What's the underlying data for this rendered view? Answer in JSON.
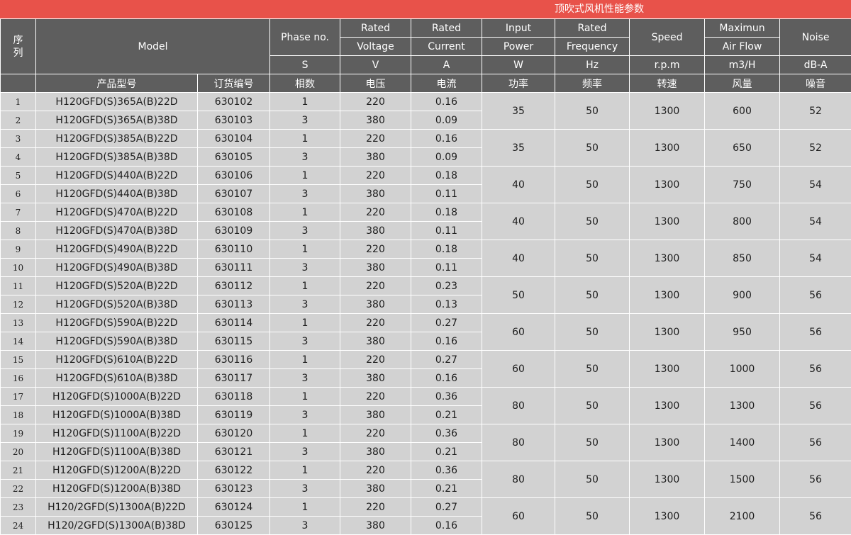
{
  "banner_title": "顶吹式风机性能参数",
  "header": {
    "seq": "序\n列",
    "model": "Model",
    "phase": "Phase no.",
    "rated_voltage_1": "Rated",
    "rated_voltage_2": "Voltage",
    "rated_current_1": "Rated",
    "rated_current_2": "Current",
    "input_power_1": "Input",
    "input_power_2": "Power",
    "rated_freq_1": "Rated",
    "rated_freq_2": "Frequency",
    "speed": "Speed",
    "airflow_1": "Maximun",
    "airflow_2": "Air Flow",
    "noise": "Noise",
    "unit_phase": "S",
    "unit_voltage": "V",
    "unit_current": "A",
    "unit_power": "W",
    "unit_freq": "Hz",
    "unit_speed": "r.p.m",
    "unit_airflow": "m3/H",
    "unit_noise": "dB-A",
    "cn_model": "产品型号",
    "cn_order": "订货编号",
    "cn_phase": "相数",
    "cn_voltage": "电压",
    "cn_current": "电流",
    "cn_power": "功率",
    "cn_freq": "频率",
    "cn_speed": "转速",
    "cn_airflow": "风量",
    "cn_noise": "噪音"
  },
  "rows": [
    {
      "idx": "1",
      "model": "H120GFD(S)365A(B)22D",
      "order": "630102",
      "phase": "1",
      "voltage": "220",
      "current": "0.16"
    },
    {
      "idx": "2",
      "model": "H120GFD(S)365A(B)38D",
      "order": "630103",
      "phase": "3",
      "voltage": "380",
      "current": "0.09"
    },
    {
      "idx": "3",
      "model": "H120GFD(S)385A(B)22D",
      "order": "630104",
      "phase": "1",
      "voltage": "220",
      "current": "0.16"
    },
    {
      "idx": "4",
      "model": "H120GFD(S)385A(B)38D",
      "order": "630105",
      "phase": "3",
      "voltage": "380",
      "current": "0.09"
    },
    {
      "idx": "5",
      "model": "H120GFD(S)440A(B)22D",
      "order": "630106",
      "phase": "1",
      "voltage": "220",
      "current": "0.18"
    },
    {
      "idx": "6",
      "model": "H120GFD(S)440A(B)38D",
      "order": "630107",
      "phase": "3",
      "voltage": "380",
      "current": "0.11"
    },
    {
      "idx": "7",
      "model": "H120GFD(S)470A(B)22D",
      "order": "630108",
      "phase": "1",
      "voltage": "220",
      "current": "0.18"
    },
    {
      "idx": "8",
      "model": "H120GFD(S)470A(B)38D",
      "order": "630109",
      "phase": "3",
      "voltage": "380",
      "current": "0.11"
    },
    {
      "idx": "9",
      "model": "H120GFD(S)490A(B)22D",
      "order": "630110",
      "phase": "1",
      "voltage": "220",
      "current": "0.18"
    },
    {
      "idx": "10",
      "model": "H120GFD(S)490A(B)38D",
      "order": "630111",
      "phase": "3",
      "voltage": "380",
      "current": "0.11"
    },
    {
      "idx": "11",
      "model": "H120GFD(S)520A(B)22D",
      "order": "630112",
      "phase": "1",
      "voltage": "220",
      "current": "0.23"
    },
    {
      "idx": "12",
      "model": "H120GFD(S)520A(B)38D",
      "order": "630113",
      "phase": "3",
      "voltage": "380",
      "current": "0.13"
    },
    {
      "idx": "13",
      "model": "H120GFD(S)590A(B)22D",
      "order": "630114",
      "phase": "1",
      "voltage": "220",
      "current": "0.27"
    },
    {
      "idx": "14",
      "model": "H120GFD(S)590A(B)38D",
      "order": "630115",
      "phase": "3",
      "voltage": "380",
      "current": "0.16"
    },
    {
      "idx": "15",
      "model": "H120GFD(S)610A(B)22D",
      "order": "630116",
      "phase": "1",
      "voltage": "220",
      "current": "0.27"
    },
    {
      "idx": "16",
      "model": "H120GFD(S)610A(B)38D",
      "order": "630117",
      "phase": "3",
      "voltage": "380",
      "current": "0.16"
    },
    {
      "idx": "17",
      "model": "H120GFD(S)1000A(B)22D",
      "order": "630118",
      "phase": "1",
      "voltage": "220",
      "current": "0.36"
    },
    {
      "idx": "18",
      "model": "H120GFD(S)1000A(B)38D",
      "order": "630119",
      "phase": "3",
      "voltage": "380",
      "current": "0.21"
    },
    {
      "idx": "19",
      "model": "H120GFD(S)1100A(B)22D",
      "order": "630120",
      "phase": "1",
      "voltage": "220",
      "current": "0.36"
    },
    {
      "idx": "20",
      "model": "H120GFD(S)1100A(B)38D",
      "order": "630121",
      "phase": "3",
      "voltage": "380",
      "current": "0.21"
    },
    {
      "idx": "21",
      "model": "H120GFD(S)1200A(B)22D",
      "order": "630122",
      "phase": "1",
      "voltage": "220",
      "current": "0.36"
    },
    {
      "idx": "22",
      "model": "H120GFD(S)1200A(B)38D",
      "order": "630123",
      "phase": "3",
      "voltage": "380",
      "current": "0.21"
    },
    {
      "idx": "23",
      "model": "H120/2GFD(S)1300A(B)22D",
      "order": "630124",
      "phase": "1",
      "voltage": "220",
      "current": "0.27"
    },
    {
      "idx": "24",
      "model": "H120/2GFD(S)1300A(B)38D",
      "order": "630125",
      "phase": "3",
      "voltage": "380",
      "current": "0.16"
    }
  ],
  "groups": [
    {
      "power": "35",
      "freq": "50",
      "speed": "1300",
      "airflow": "600",
      "noise": "52"
    },
    {
      "power": "35",
      "freq": "50",
      "speed": "1300",
      "airflow": "650",
      "noise": "52"
    },
    {
      "power": "40",
      "freq": "50",
      "speed": "1300",
      "airflow": "750",
      "noise": "54"
    },
    {
      "power": "40",
      "freq": "50",
      "speed": "1300",
      "airflow": "800",
      "noise": "54"
    },
    {
      "power": "40",
      "freq": "50",
      "speed": "1300",
      "airflow": "850",
      "noise": "54"
    },
    {
      "power": "50",
      "freq": "50",
      "speed": "1300",
      "airflow": "900",
      "noise": "56"
    },
    {
      "power": "60",
      "freq": "50",
      "speed": "1300",
      "airflow": "950",
      "noise": "56"
    },
    {
      "power": "60",
      "freq": "50",
      "speed": "1300",
      "airflow": "1000",
      "noise": "56"
    },
    {
      "power": "80",
      "freq": "50",
      "speed": "1300",
      "airflow": "1300",
      "noise": "56"
    },
    {
      "power": "80",
      "freq": "50",
      "speed": "1300",
      "airflow": "1400",
      "noise": "56"
    },
    {
      "power": "80",
      "freq": "50",
      "speed": "1300",
      "airflow": "1500",
      "noise": "56"
    },
    {
      "power": "60",
      "freq": "50",
      "speed": "1300",
      "airflow": "2100",
      "noise": "56"
    }
  ]
}
